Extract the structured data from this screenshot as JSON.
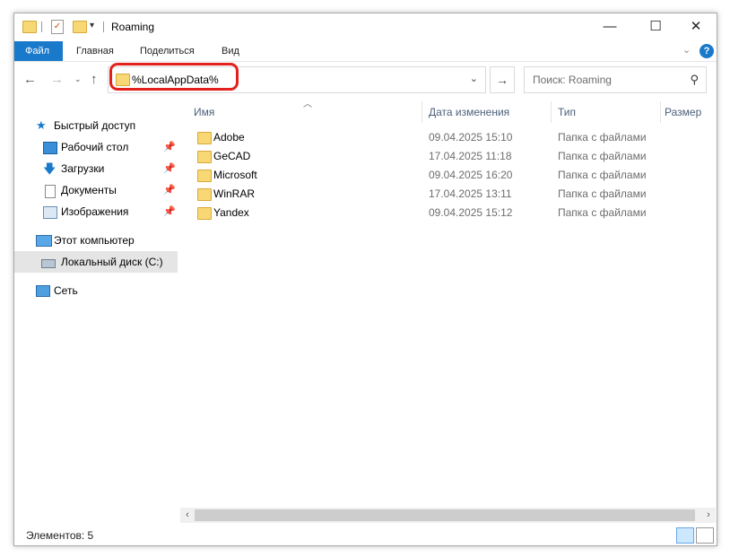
{
  "window": {
    "title": "Roaming"
  },
  "ribbon": {
    "tabs": [
      "Файл",
      "Главная",
      "Поделиться",
      "Вид"
    ]
  },
  "address": {
    "value": "%LocalAppData%"
  },
  "search": {
    "placeholder": "Поиск: Roaming"
  },
  "nav": {
    "quick_access": "Быстрый доступ",
    "items": [
      "Рабочий стол",
      "Загрузки",
      "Документы",
      "Изображения"
    ],
    "this_pc": "Этот компьютер",
    "local_disk": "Локальный диск (C:)",
    "network": "Сеть"
  },
  "columns": {
    "name": "Имя",
    "date": "Дата изменения",
    "type": "Тип",
    "size": "Размер"
  },
  "files": [
    {
      "name": "Adobe",
      "date": "09.04.2025 15:10",
      "type": "Папка с файлами"
    },
    {
      "name": "GeCAD",
      "date": "17.04.2025 11:18",
      "type": "Папка с файлами"
    },
    {
      "name": "Microsoft",
      "date": "09.04.2025 16:20",
      "type": "Папка с файлами"
    },
    {
      "name": "WinRAR",
      "date": "17.04.2025 13:11",
      "type": "Папка с файлами"
    },
    {
      "name": "Yandex",
      "date": "09.04.2025 15:12",
      "type": "Папка с файлами"
    }
  ],
  "status": {
    "text": "Элементов: 5"
  },
  "colors": {
    "accent": "#1979ca",
    "highlight": "#e3201b",
    "folder": "#f8d775"
  }
}
